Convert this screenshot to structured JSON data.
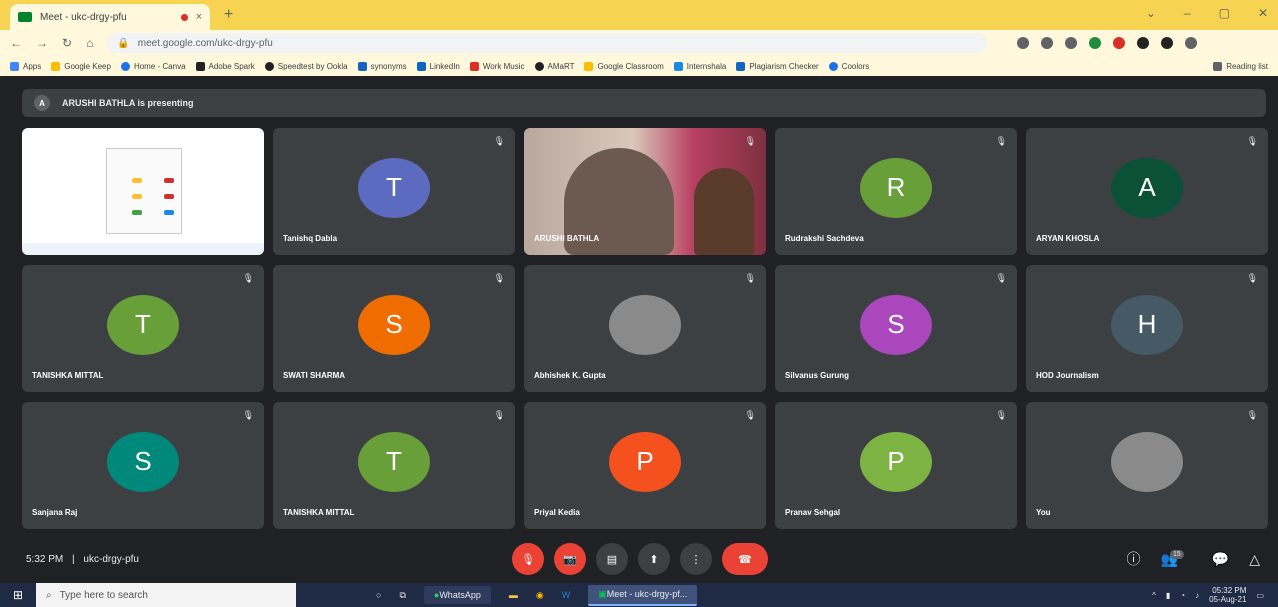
{
  "browser": {
    "tab_title": "Meet - ukc-drgy-pfu",
    "tab_close": "×",
    "new_tab": "+",
    "url": "meet.google.com/ukc-drgy-pfu",
    "window_controls": [
      "⌄",
      "–",
      "▢",
      "✕"
    ],
    "bookmarks": [
      "Apps",
      "Google Keep",
      "Home - Canva",
      "Adobe Spark",
      "Speedtest by Ookla",
      "synonyms",
      "LinkedIn",
      "Work Music",
      "AMaRT",
      "Google Classroom",
      "Internshala",
      "Plagiarism Checker",
      "Coolors",
      "Reading list"
    ]
  },
  "meet": {
    "presenting_avatar": "A",
    "presenting_text": "ARUSHI BATHLA is presenting",
    "meeting_time": "5:32 PM",
    "meeting_code": "ukc-drgy-pfu",
    "separator": "|",
    "participants_count": "15",
    "tiles": [
      {
        "kind": "screen",
        "name": ""
      },
      {
        "kind": "avatar",
        "initial": "T",
        "name": "Tanishq Dabla",
        "color": "#5c6bc0"
      },
      {
        "kind": "video",
        "name": "ARUSHI BATHLA"
      },
      {
        "kind": "avatar",
        "initial": "R",
        "name": "Rudrakshi Sachdeva",
        "color": "#689f38"
      },
      {
        "kind": "avatar",
        "initial": "A",
        "name": "ARYAN KHOSLA",
        "color": "#0b5138"
      },
      {
        "kind": "avatar",
        "initial": "T",
        "name": "TANISHKA MITTAL",
        "color": "#689f38"
      },
      {
        "kind": "avatar",
        "initial": "S",
        "name": "SWATI SHARMA",
        "color": "#ef6c00"
      },
      {
        "kind": "photo",
        "initial": "",
        "name": "Abhishek K. Gupta"
      },
      {
        "kind": "avatar",
        "initial": "S",
        "name": "Silvanus Gurung",
        "color": "#ab47bc"
      },
      {
        "kind": "avatar",
        "initial": "H",
        "name": "HOD Journalism",
        "color": "#455a64"
      },
      {
        "kind": "avatar",
        "initial": "S",
        "name": "Sanjana Raj",
        "color": "#00897b"
      },
      {
        "kind": "avatar",
        "initial": "T",
        "name": "TANISHKA MITTAL",
        "color": "#689f38"
      },
      {
        "kind": "avatar",
        "initial": "P",
        "name": "Priyal Kedia",
        "color": "#f4511e"
      },
      {
        "kind": "avatar",
        "initial": "P",
        "name": "Pranav Sehgal",
        "color": "#7cb342"
      },
      {
        "kind": "photo",
        "initial": "",
        "name": "You"
      }
    ]
  },
  "taskbar": {
    "search_placeholder": "Type here to search",
    "whatsapp_label": "WhatsApp",
    "meet_label": "Meet - ukc-drgy-pf...",
    "time": "05:32 PM",
    "date": "05-Aug-21"
  }
}
